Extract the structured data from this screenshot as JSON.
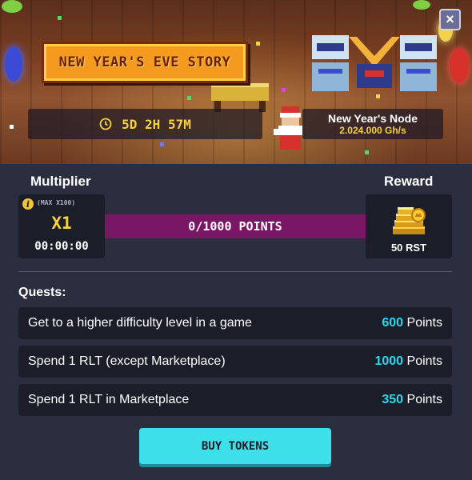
{
  "banner": {
    "title": "NEW YEAR'S EVE STORY",
    "timer": "5D 2H 57M",
    "node_name": "New Year's Node",
    "node_power": "2.024.000 Gh/s",
    "close_label": "×"
  },
  "multiplier": {
    "label": "Multiplier",
    "max_text": "(MAX X100)",
    "value": "X1",
    "time": "00:00:00"
  },
  "progress": {
    "text": "0/1000 POINTS",
    "current": 0,
    "total": 1000
  },
  "reward": {
    "label": "Reward",
    "amount": "50 RST"
  },
  "quests": {
    "label": "Quests:",
    "points_suffix": "Points",
    "items": [
      {
        "text": "Get to a higher difficulty level in a game",
        "points": "600"
      },
      {
        "text": "Spend 1 RLT (except Marketplace)",
        "points": "1000"
      },
      {
        "text": "Spend 1 RLT in Marketplace",
        "points": "350"
      }
    ]
  },
  "buy_button": {
    "label": "BUY TOKENS"
  },
  "colors": {
    "background": "#2b2e3f",
    "panel": "#1b1d29",
    "accent_cyan": "#3de0e8",
    "accent_yellow": "#f7d23c",
    "progress_track": "#7a1764"
  },
  "icons": {
    "clock": "clock-icon",
    "info": "info-icon",
    "coins": "coins-icon",
    "close": "close-icon"
  }
}
